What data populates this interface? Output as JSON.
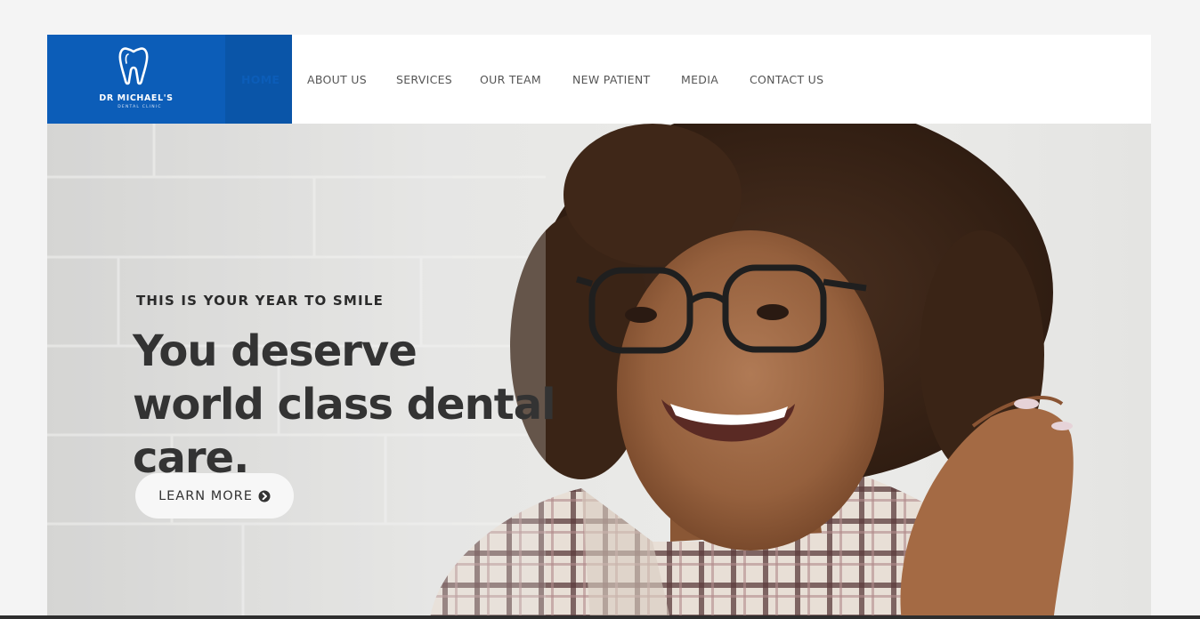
{
  "brand": {
    "name": "DR MICHAEL'S",
    "tagline": "DENTAL CLINIC",
    "accent_color": "#0c5db8"
  },
  "nav": {
    "items": [
      {
        "label": "HOME",
        "active": true
      },
      {
        "label": "ABOUT US",
        "active": false
      },
      {
        "label": "SERVICES",
        "active": false
      },
      {
        "label": "OUR TEAM",
        "active": false
      },
      {
        "label": "NEW PATIENT",
        "active": false
      },
      {
        "label": "MEDIA",
        "active": false
      },
      {
        "label": "CONTACT US",
        "active": false
      }
    ]
  },
  "hero": {
    "eyebrow": "THIS IS YOUR YEAR TO SMILE",
    "headline": "You deserve world class dental care.",
    "cta_label": "LEARN MORE",
    "cta_icon": "chevron-circle-right-icon"
  }
}
